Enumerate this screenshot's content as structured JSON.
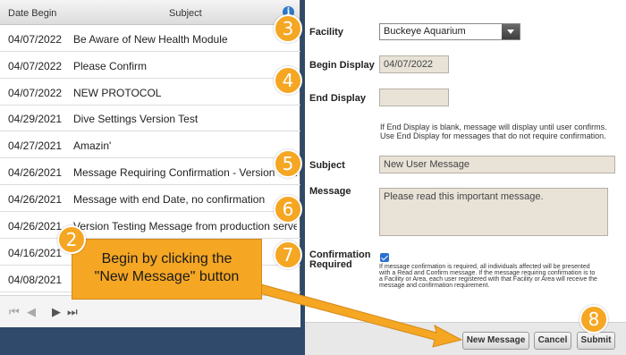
{
  "table": {
    "header_date": "Date Begin",
    "header_subject": "Subject",
    "info_icon": "i",
    "rows": [
      {
        "date": "04/07/2022",
        "subject": "Be Aware of New Health Module"
      },
      {
        "date": "04/07/2022",
        "subject": "Please Confirm"
      },
      {
        "date": "04/07/2022",
        "subject": "NEW PROTOCOL"
      },
      {
        "date": "04/29/2021",
        "subject": "Dive Settings Version Test"
      },
      {
        "date": "04/27/2021",
        "subject": "Amazin'"
      },
      {
        "date": "04/26/2021",
        "subject": "Message Requiring Confirmation - Version Test"
      },
      {
        "date": "04/26/2021",
        "subject": "Message with end Date, no confirmation"
      },
      {
        "date": "04/26/2021",
        "subject": "Version Testing Message from production server"
      },
      {
        "date": "04/16/2021",
        "subject": ""
      },
      {
        "date": "04/08/2021",
        "subject": ""
      }
    ]
  },
  "pager": {
    "first": "⏮",
    "prev": "◀",
    "next": "▶",
    "last": "⏭"
  },
  "form": {
    "facility_label": "Facility",
    "facility_value": "Buckeye Aquarium",
    "begin_label": "Begin Display",
    "begin_value": "04/07/2022",
    "end_label": "End Display",
    "end_value": "",
    "end_note_line1": "If End Display is blank, message will display until user confirms.",
    "end_note_line2": "Use End Display for messages that do not require confirmation.",
    "subject_label": "Subject",
    "subject_value": "New User Message",
    "message_label": "Message",
    "message_value": "Please read this important message.",
    "confirm_label_1": "Confirmation",
    "confirm_label_2": "Required",
    "confirm_checked": true,
    "confirm_note_1": "If message confirmation is required, all individuals affected will be presented",
    "confirm_note_2": "with a Read and Confirm message. If the message requiring confirmation is to",
    "confirm_note_3": "a Facility or Area, each user registered with that Facility or Area will receive the",
    "confirm_note_4": "message and confirmation requirement."
  },
  "buttons": {
    "new_message": "New Message",
    "cancel": "Cancel",
    "submit": "Submit"
  },
  "annotations": {
    "callout_line1": "Begin by clicking the",
    "callout_line2": "\"New Message\" button",
    "badge_2": "2",
    "badge_3": "3",
    "badge_4": "4",
    "badge_5": "5",
    "badge_6": "6",
    "badge_7": "7",
    "badge_8": "8"
  },
  "colors": {
    "accent_orange": "#f5a623",
    "info_blue": "#2c78c8",
    "field_beige": "#e8e2d7",
    "frame_navy": "#2f4a6a"
  }
}
